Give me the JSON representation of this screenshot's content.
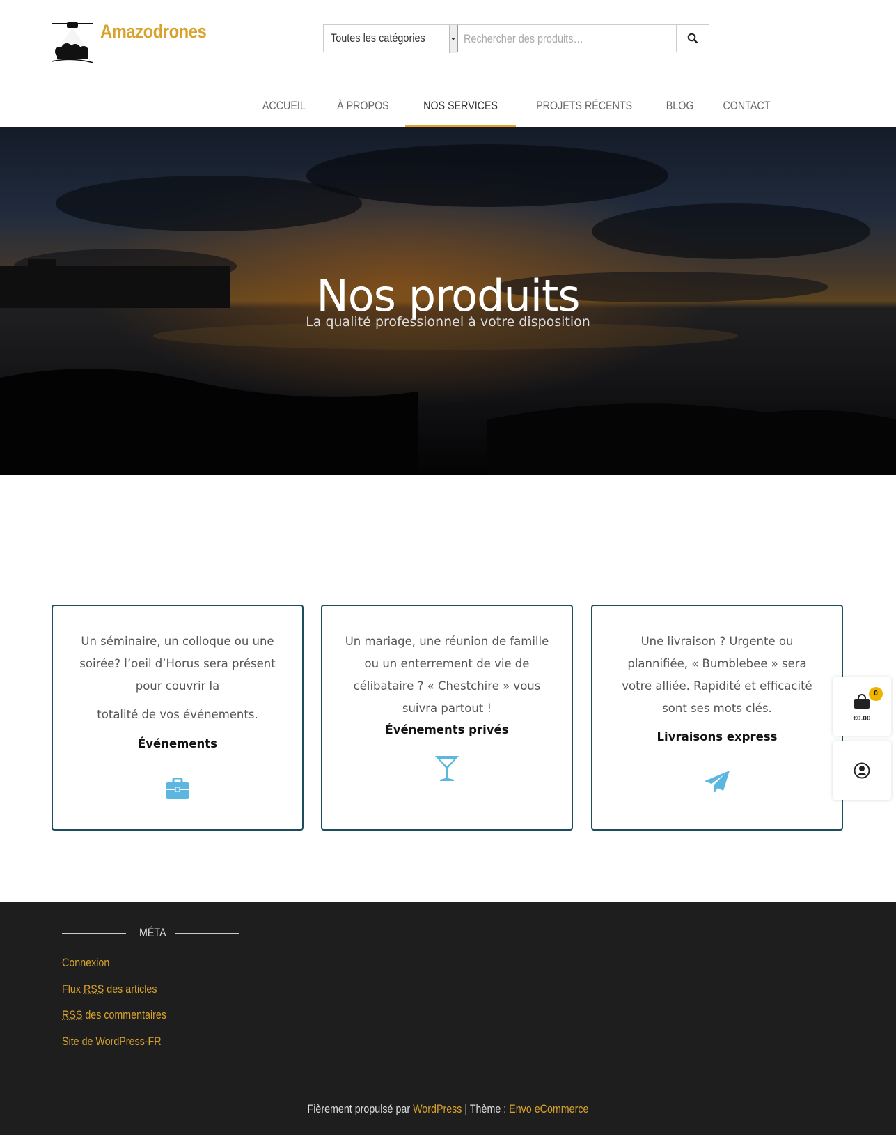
{
  "brand": {
    "name": "Amazodrones",
    "color": "#d9a22c",
    "logo_icon": "drone-logo-icon"
  },
  "search": {
    "category": "Toutes les catégories",
    "placeholder": "Rechercher des produits…"
  },
  "nav": {
    "items": [
      {
        "label": "ACCUEIL"
      },
      {
        "label": "À PROPOS"
      },
      {
        "label": "NOS SERVICES",
        "active": true
      },
      {
        "label": "PROJETS RÉCENTS"
      },
      {
        "label": "BLOG"
      },
      {
        "label": "CONTACT"
      }
    ],
    "accent": "#e9a32b"
  },
  "hero": {
    "title": "Nos produits",
    "subtitle": "La qualité professionnel à votre disposition"
  },
  "cards": [
    {
      "desc": "Un séminaire, un colloque ou une soirée? l’oeil d’Horus sera présent pour couvrir la",
      "desc2": "totalité de vos événements.",
      "title": "Événements",
      "icon": "briefcase-icon"
    },
    {
      "desc": "Un mariage, une réunion de famille ou un enterrement de vie de célibataire ? « Chestchire » vous suivra partout !",
      "title": "Événements privés",
      "icon": "cocktail-glass-icon"
    },
    {
      "desc": "Une livraison ? Urgente ou plannifiée, « Bumblebee » sera votre alliée. Rapidité et efficacité sont ses mots clés.",
      "title": "Livraisons express",
      "icon": "paper-plane-icon"
    }
  ],
  "icon_color": "#5bb6e0",
  "cart": {
    "count": "0",
    "total": "€0.00"
  },
  "footer": {
    "meta_title": "MÉTA",
    "links": {
      "login": "Connexion",
      "rss_articles_pre": "Flux ",
      "rss_abbr": "RSS",
      "rss_articles_post": " des articles",
      "rss_comments_post": " des commentaires",
      "wp_fr": "Site de WordPress-FR"
    },
    "credits": {
      "pre": "Fièrement propulsé par ",
      "wp": "WordPress",
      "sep": " | Thème : ",
      "theme": "Envo eCommerce"
    }
  }
}
